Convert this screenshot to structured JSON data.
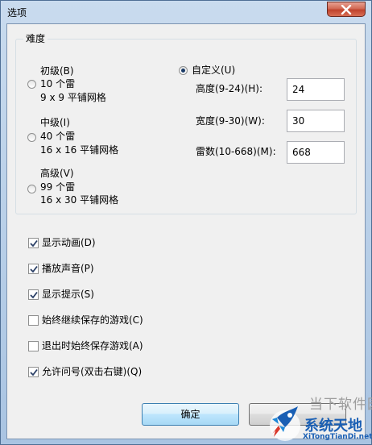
{
  "window": {
    "title": "选项"
  },
  "difficulty": {
    "group_title": "难度",
    "beginner": {
      "label": "初级(B)",
      "mines": "10 个雷",
      "grid": "9 x 9 平铺网格"
    },
    "intermediate": {
      "label": "中级(I)",
      "mines": "40 个雷",
      "grid": "16 x 16 平铺网格"
    },
    "advanced": {
      "label": "高级(V)",
      "mines": "99 个雷",
      "grid": "16 x 30 平铺网格"
    },
    "custom": {
      "label": "自定义(U)",
      "selected": true,
      "height_label": "高度(9-24)(H):",
      "height_value": "24",
      "width_label": "宽度(9-30)(W):",
      "width_value": "30",
      "mines_label": "雷数(10-668)(M):",
      "mines_value": "668"
    }
  },
  "options": [
    {
      "label": "显示动画(D)",
      "checked": true
    },
    {
      "label": "播放声音(P)",
      "checked": true
    },
    {
      "label": "显示提示(S)",
      "checked": true
    },
    {
      "label": "始终继续保存的游戏(C)",
      "checked": false
    },
    {
      "label": "退出时始终保存游戏(A)",
      "checked": false
    },
    {
      "label": "允许问号(双击右键)(Q)",
      "checked": true
    }
  ],
  "buttons": {
    "ok": "确定"
  },
  "watermark": {
    "top": "当下软件园",
    "name": "系统天地",
    "url": "XiTongTianDi.net"
  },
  "colors": {
    "accent": "#1a5fb4",
    "close": "#c0432d"
  },
  "icons": {
    "close": "close-icon",
    "check": "checkmark-icon",
    "watermark": "rocket-logo-icon"
  }
}
